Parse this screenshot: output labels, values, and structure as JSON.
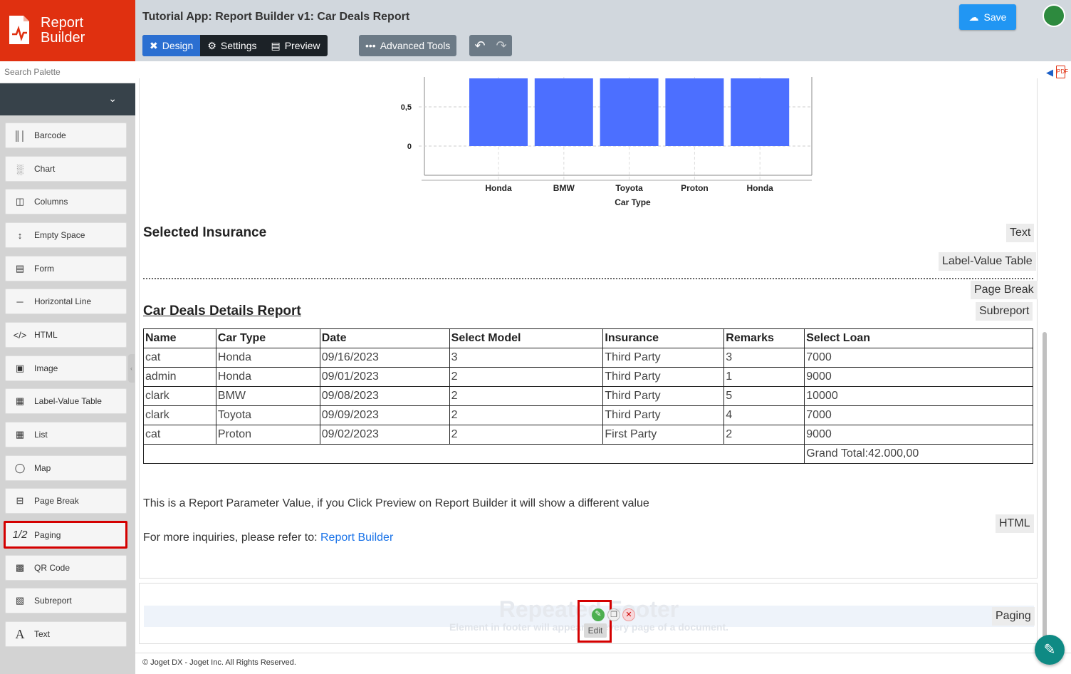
{
  "brand": {
    "line1": "Report",
    "line2": "Builder"
  },
  "search": {
    "placeholder": "Search Palette"
  },
  "palette": [
    {
      "label": "Barcode",
      "icon": "barcode-icon"
    },
    {
      "label": "Chart",
      "icon": "chart-icon"
    },
    {
      "label": "Columns",
      "icon": "columns-icon"
    },
    {
      "label": "Empty Space",
      "icon": "empty-space-icon"
    },
    {
      "label": "Form",
      "icon": "form-icon"
    },
    {
      "label": "Horizontal Line",
      "icon": "horizontal-line-icon"
    },
    {
      "label": "HTML",
      "icon": "html-icon"
    },
    {
      "label": "Image",
      "icon": "image-icon"
    },
    {
      "label": "Label-Value Table",
      "icon": "table-icon"
    },
    {
      "label": "List",
      "icon": "list-icon"
    },
    {
      "label": "Map",
      "icon": "map-icon"
    },
    {
      "label": "Page Break",
      "icon": "page-break-icon"
    },
    {
      "label": "Paging",
      "icon": "paging-icon",
      "glyph": "1/2"
    },
    {
      "label": "QR Code",
      "icon": "qr-code-icon"
    },
    {
      "label": "Subreport",
      "icon": "subreport-icon"
    },
    {
      "label": "Text",
      "icon": "text-icon",
      "glyph": "A"
    }
  ],
  "header": {
    "title": "Tutorial App: Report Builder v1: Car Deals Report",
    "tabs": {
      "design": "Design",
      "settings": "Settings",
      "preview": "Preview"
    },
    "advanced": "Advanced Tools",
    "save": "Save"
  },
  "chart_data": {
    "type": "bar",
    "categories": [
      "Honda",
      "BMW",
      "Toyota",
      "Proton",
      "Honda"
    ],
    "values": [
      1,
      1,
      1,
      1,
      1
    ],
    "xlabel": "Car Type",
    "ylabel": "",
    "yticks": [
      "0",
      "0,5"
    ],
    "ylim": [
      0,
      1
    ],
    "color": "#4c6fff",
    "grid": true
  },
  "selected_insurance": "Selected Insurance",
  "tags": {
    "text": "Text",
    "label_value_table": "Label-Value Table",
    "page_break": "Page Break",
    "subreport": "Subreport",
    "html": "HTML",
    "paging": "Paging"
  },
  "report_title": "Car Deals Details Report",
  "table": {
    "headers": [
      "Name",
      "Car Type",
      "Date",
      "Select Model",
      "Insurance",
      "Remarks",
      "Select Loan"
    ],
    "rows": [
      [
        "cat",
        "Honda",
        "09/16/2023",
        "3",
        "Third Party",
        "3",
        "7000"
      ],
      [
        "admin",
        "Honda",
        "09/01/2023",
        "2",
        "Third Party",
        "1",
        "9000"
      ],
      [
        "clark",
        "BMW",
        "09/08/2023",
        "2",
        "Third Party",
        "5",
        "10000"
      ],
      [
        "clark",
        "Toyota",
        "09/09/2023",
        "2",
        "Third Party",
        "4",
        "7000"
      ],
      [
        "cat",
        "Proton",
        "09/02/2023",
        "2",
        "First Party",
        "2",
        "9000"
      ]
    ],
    "grand_total": "Grand Total:42.000,00"
  },
  "param_text": "This is a Report Parameter Value, if you Click Preview on Report Builder it will show a different value",
  "inquiry": {
    "prefix": "For more inquiries, please refer to: ",
    "link": "Report Builder"
  },
  "footer": {
    "title": "Repeated Footer",
    "subtitle": "Element in footer will appear on every page of a document."
  },
  "edit_tooltip": "Edit",
  "copyright": "© Joget DX - Joget Inc. All Rights Reserved."
}
